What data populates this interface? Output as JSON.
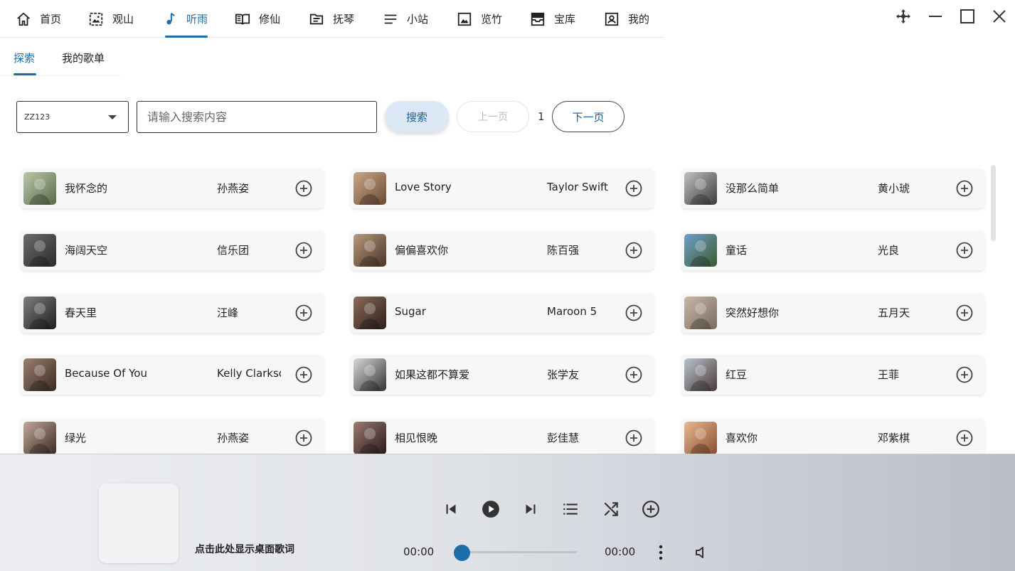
{
  "nav": {
    "items": [
      {
        "label": "首页",
        "icon": "home-icon"
      },
      {
        "label": "观山",
        "icon": "image-frame-icon"
      },
      {
        "label": "听雨",
        "icon": "music-note-icon",
        "active": true
      },
      {
        "label": "修仙",
        "icon": "book-icon"
      },
      {
        "label": "抚琴",
        "icon": "folder-icon"
      },
      {
        "label": "小站",
        "icon": "menu-lines-icon"
      },
      {
        "label": "览竹",
        "icon": "picture-icon"
      },
      {
        "label": "宝库",
        "icon": "inbox-icon"
      },
      {
        "label": "我的",
        "icon": "user-portrait-icon"
      }
    ],
    "accent": "#1b6ea8"
  },
  "subtabs": [
    {
      "label": "探索",
      "active": true
    },
    {
      "label": "我的歌单"
    }
  ],
  "search": {
    "source_value": "ZZ123",
    "placeholder": "请输入搜索内容",
    "search_label": "搜索",
    "prev_label": "上一页",
    "page": "1",
    "next_label": "下一页"
  },
  "songs": [
    {
      "title": "我怀念的",
      "artist": "孙燕姿"
    },
    {
      "title": "Love Story",
      "artist": "Taylor Swift"
    },
    {
      "title": "没那么简单",
      "artist": "黄小琥"
    },
    {
      "title": "海阔天空",
      "artist": "信乐团"
    },
    {
      "title": "偏偏喜欢你",
      "artist": "陈百强"
    },
    {
      "title": "童话",
      "artist": "光良"
    },
    {
      "title": "春天里",
      "artist": "汪峰"
    },
    {
      "title": "Sugar",
      "artist": "Maroon 5"
    },
    {
      "title": "突然好想你",
      "artist": "五月天"
    },
    {
      "title": "Because Of You",
      "artist": "Kelly Clarkson"
    },
    {
      "title": "如果这都不算爱",
      "artist": "张学友"
    },
    {
      "title": "红豆",
      "artist": "王菲"
    },
    {
      "title": "绿光",
      "artist": "孙燕姿"
    },
    {
      "title": "相见恨晚",
      "artist": "彭佳慧"
    },
    {
      "title": "喜欢你",
      "artist": "邓紫棋"
    }
  ],
  "player": {
    "lyric_label": "点击此处显示桌面歌词",
    "current_time": "00:00",
    "total_time": "00:00",
    "progress": 0
  }
}
